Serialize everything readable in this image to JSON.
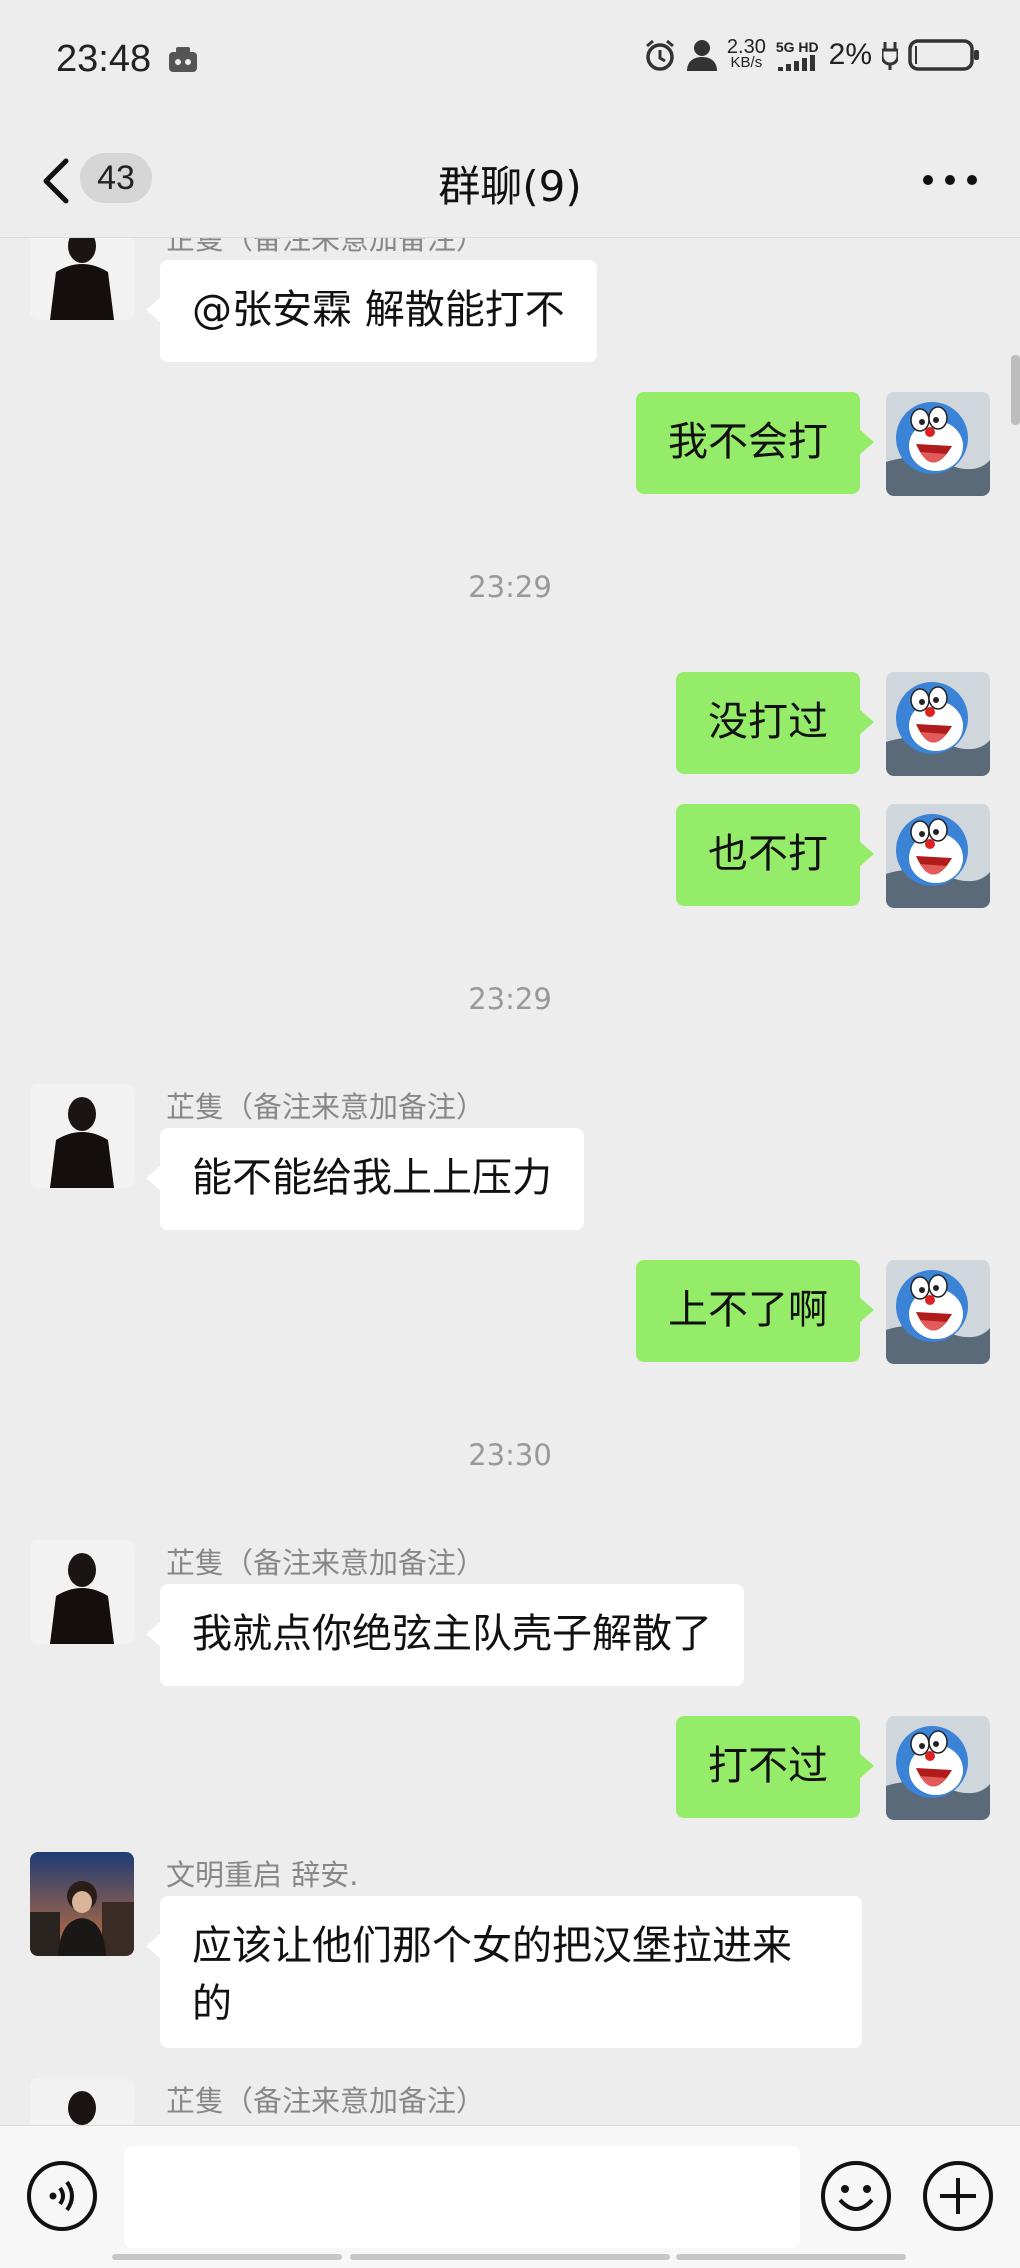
{
  "status": {
    "time": "23:48",
    "speed": "2.30",
    "speed_unit": "KB/s",
    "network": "5G HD",
    "battery": "2%"
  },
  "nav": {
    "unread": "43",
    "title": "群聊(9)"
  },
  "messages": [
    {
      "type": "in",
      "sender": "芷隻（备注来意加备注）",
      "text": "@张安霖  解散能打不",
      "avatar": "dark"
    },
    {
      "type": "out",
      "text": "我不会打"
    },
    {
      "type": "time",
      "text": "23:29"
    },
    {
      "type": "out",
      "text": "没打过"
    },
    {
      "type": "out",
      "text": "也不打"
    },
    {
      "type": "time",
      "text": "23:29"
    },
    {
      "type": "in",
      "sender": "芷隻（备注来意加备注）",
      "text": "能不能给我上上压力",
      "avatar": "dark"
    },
    {
      "type": "out",
      "text": "上不了啊"
    },
    {
      "type": "time",
      "text": "23:30"
    },
    {
      "type": "in",
      "sender": "芷隻（备注来意加备注）",
      "text": "我就点你绝弦主队壳子解散了",
      "avatar": "dark"
    },
    {
      "type": "out",
      "text": "打不过"
    },
    {
      "type": "in",
      "sender": "文明重启 辞安.",
      "text": "应该让他们那个女的把汉堡拉进来的",
      "avatar": "photo"
    },
    {
      "type": "in",
      "sender": "芷隻（备注来意加备注）",
      "text": "",
      "avatar": "dark"
    }
  ],
  "icons": {
    "voice": "voice-icon",
    "emoji": "emoji-icon",
    "plus": "plus-icon"
  }
}
